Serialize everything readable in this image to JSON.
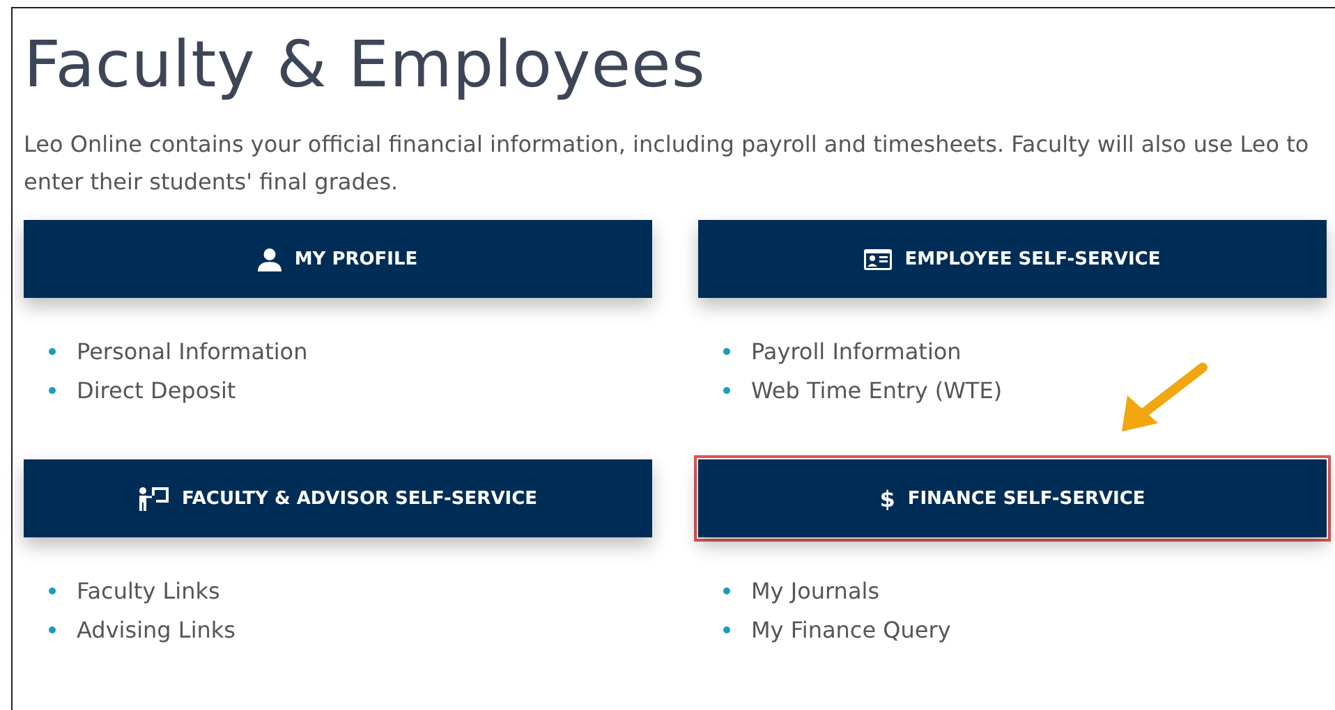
{
  "title": "Faculty & Employees",
  "intro": "Leo Online contains your official financial information, including payroll and timesheets. Faculty will also use Leo to enter their students' final grades.",
  "cards": [
    {
      "label": "MY PROFILE",
      "kind": "person",
      "highlighted": false,
      "links": [
        "Personal Information",
        "Direct Deposit"
      ]
    },
    {
      "label": "EMPLOYEE SELF-SERVICE",
      "kind": "id-card",
      "highlighted": false,
      "links": [
        "Payroll Information",
        "Web Time Entry (WTE)"
      ]
    },
    {
      "label": "FACULTY & ADVISOR SELF-SERVICE",
      "kind": "presenter",
      "highlighted": false,
      "links": [
        "Faculty Links",
        "Advising Links"
      ]
    },
    {
      "label": "FINANCE SELF-SERVICE",
      "kind": "dollar",
      "symbol": "$",
      "highlighted": true,
      "links": [
        "My Journals",
        "My Finance Query"
      ]
    }
  ]
}
